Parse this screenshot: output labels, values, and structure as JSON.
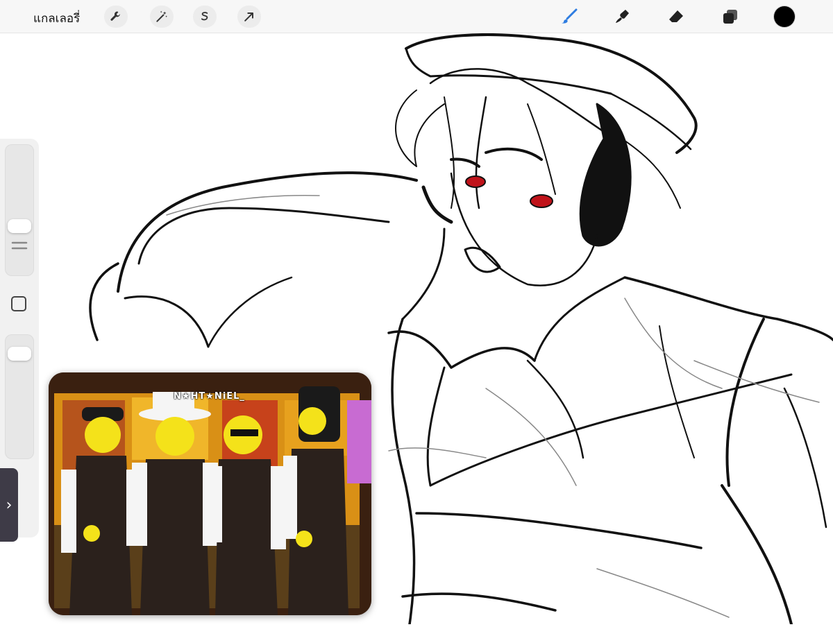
{
  "toolbar": {
    "gallery_label": "แกลเลอรี่",
    "left_tools": [
      "wrench-icon",
      "magic-wand-icon",
      "selection-icon",
      "transform-arrow-icon"
    ],
    "right_tools": [
      "brush-icon",
      "smudge-icon",
      "eraser-icon",
      "layers-icon"
    ],
    "active_tool": "brush-icon",
    "active_tool_color": "#2f7de1",
    "current_color": "#000000"
  },
  "sidebar": {
    "toggle_glyph": "›"
  },
  "reference": {
    "watermark": "N★HT★NiEL_"
  }
}
